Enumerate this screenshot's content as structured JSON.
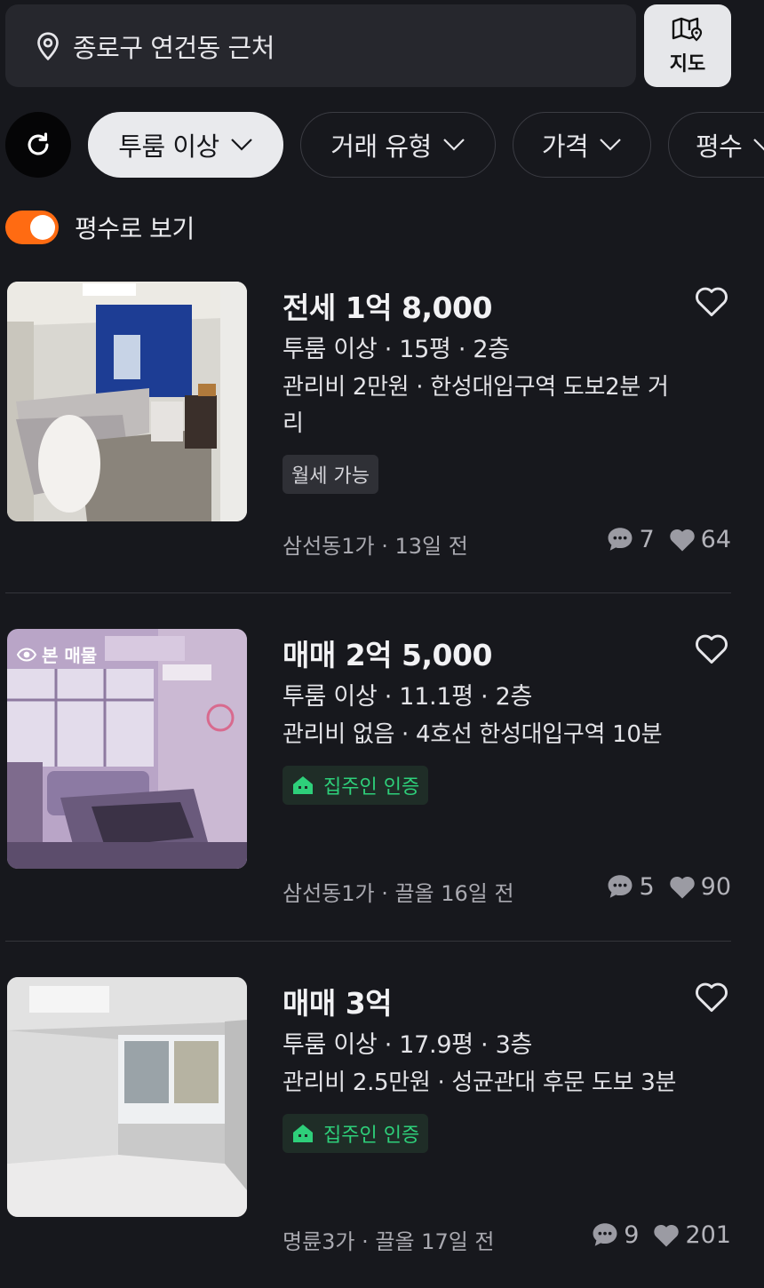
{
  "search": {
    "location": "종로구 연건동 근처",
    "map_label": "지도"
  },
  "filters": [
    {
      "label": "투룸 이상",
      "active": true
    },
    {
      "label": "거래 유형",
      "active": false
    },
    {
      "label": "가격",
      "active": false
    },
    {
      "label": "평수",
      "active": false
    }
  ],
  "toggle": {
    "label": "평수로 보기",
    "on": true
  },
  "listings": [
    {
      "price": "전세 1억 8,000",
      "specs": "투룸 이상 · 15평 · 2층",
      "desc": "관리비 2만원 · 한성대입구역 도보2분 거리",
      "tag": "월세 가능",
      "location_time": "삼선동1가 · 13일 전",
      "comments": "7",
      "likes": "64"
    },
    {
      "badge": "본 매물",
      "price": "매매 2억 5,000",
      "specs": "투룸 이상 · 11.1평 · 2층",
      "desc": "관리비 없음 · 4호선 한성대입구역 10분",
      "tag": "집주인 인증",
      "location_time": "삼선동1가 · 끌올 16일 전",
      "comments": "5",
      "likes": "90"
    },
    {
      "price": "매매 3억",
      "specs": "투룸 이상 · 17.9평 · 3층",
      "desc": "관리비 2.5만원 · 성균관대 후문 도보 3분",
      "tag": "집주인 인증",
      "location_time": "명륜3가 · 끌올 17일 전",
      "comments": "9",
      "likes": "201"
    }
  ],
  "colors": {
    "accent": "#ff6b12",
    "verified": "#2ecf7a",
    "background": "#17181d"
  }
}
